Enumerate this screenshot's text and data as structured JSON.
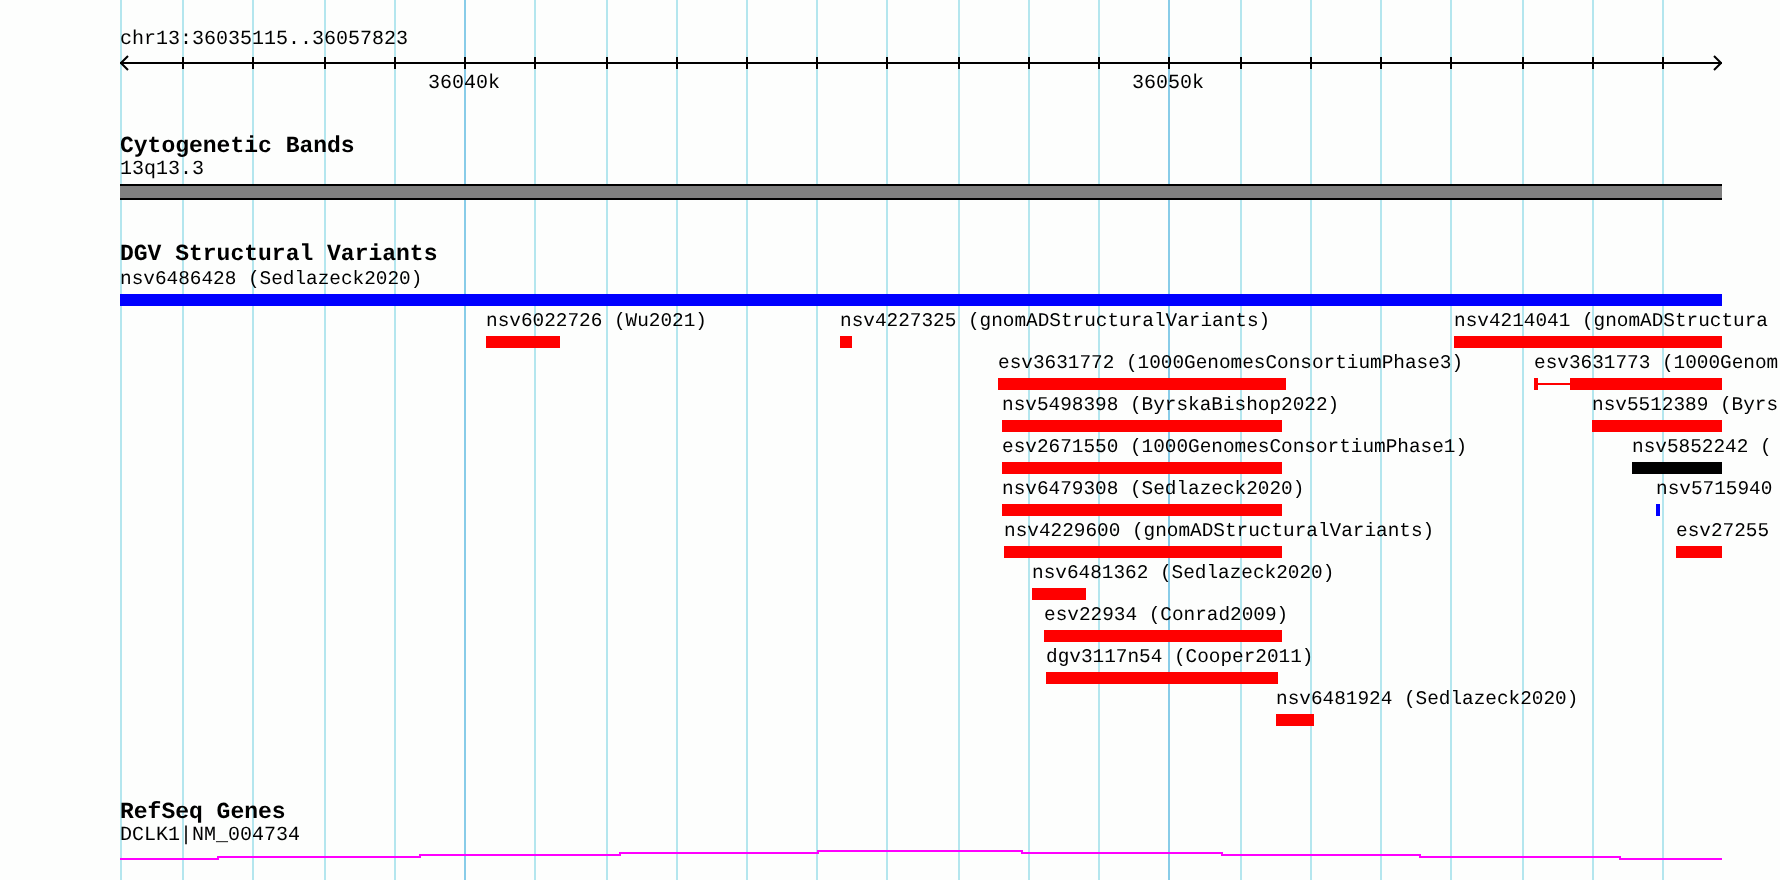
{
  "ruler": {
    "location": "chr13:36035115..36057823",
    "tick_labels": [
      "36040k",
      "36050k"
    ]
  },
  "tracks": [
    {
      "kind": "bands",
      "title": "Cytogenetic Bands",
      "features": [
        {
          "label": "13q13.3",
          "color": "#808080"
        }
      ]
    },
    {
      "kind": "variants",
      "title": "DGV Structural Variants",
      "features": [
        {
          "label": "nsv6486428 (Sedlazeck2020)",
          "color": "#0000ff"
        },
        {
          "label": "nsv6022726 (Wu2021)",
          "color": "#ff0000"
        },
        {
          "label": "nsv4227325 (gnomADStructuralVariants)",
          "color": "#ff0000"
        },
        {
          "label": "nsv4214041 (gnomADStructura",
          "color": "#ff0000"
        },
        {
          "label": "esv3631772 (1000GenomesConsortiumPhase3)",
          "color": "#ff0000"
        },
        {
          "label": "esv3631773 (1000Genom",
          "color": "#ff0000"
        },
        {
          "label": "nsv5498398 (ByrskaBishop2022)",
          "color": "#ff0000"
        },
        {
          "label": "nsv5512389 (Byrs",
          "color": "#ff0000"
        },
        {
          "label": "esv2671550 (1000GenomesConsortiumPhase1)",
          "color": "#ff0000"
        },
        {
          "label": "nsv5852242 (",
          "color": "#000000"
        },
        {
          "label": "nsv6479308 (Sedlazeck2020)",
          "color": "#ff0000"
        },
        {
          "label": "nsv5715940",
          "color": "#0000ff"
        },
        {
          "label": "nsv4229600 (gnomADStructuralVariants)",
          "color": "#ff0000"
        },
        {
          "label": "esv27255",
          "color": "#ff0000"
        },
        {
          "label": "nsv6481362 (Sedlazeck2020)",
          "color": "#ff0000"
        },
        {
          "label": "esv22934 (Conrad2009)",
          "color": "#ff0000"
        },
        {
          "label": "dgv3117n54 (Cooper2011)",
          "color": "#ff0000"
        },
        {
          "label": "nsv6481924 (Sedlazeck2020)",
          "color": "#ff0000"
        }
      ]
    },
    {
      "kind": "genes",
      "title": "RefSeq Genes",
      "features": [
        {
          "label": "DCLK1|NM_004734",
          "color": "#ff00ff"
        }
      ]
    }
  ]
}
